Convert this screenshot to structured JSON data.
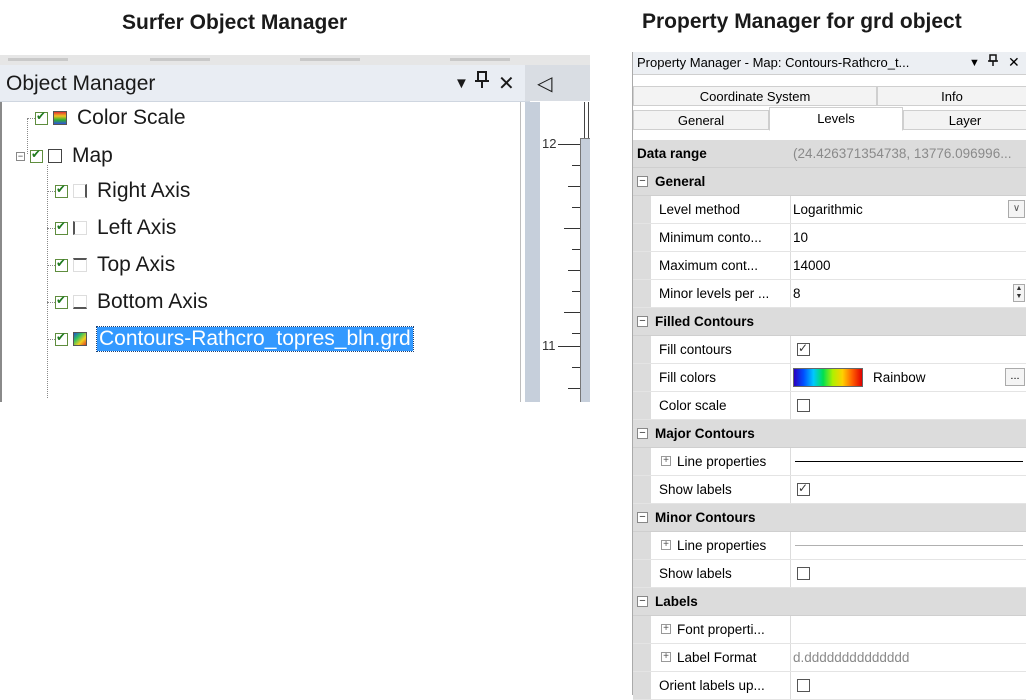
{
  "headings": {
    "left": "Surfer Object Manager",
    "right": "Property Manager for grd object"
  },
  "object_manager": {
    "title": "Object Manager",
    "title_icons": [
      "dropdown-arrow-icon",
      "pin-icon",
      "close-icon"
    ],
    "items": [
      {
        "label": "Color Scale",
        "checked": true,
        "icon": "color-scale-icon"
      },
      {
        "label": "Map",
        "checked": true,
        "icon": "map-icon",
        "expanded": true
      },
      {
        "label": "Right Axis",
        "checked": true,
        "icon": "right-axis-icon"
      },
      {
        "label": "Left Axis",
        "checked": true,
        "icon": "left-axis-icon"
      },
      {
        "label": "Top Axis",
        "checked": true,
        "icon": "top-axis-icon"
      },
      {
        "label": "Bottom Axis",
        "checked": true,
        "icon": "bottom-axis-icon"
      },
      {
        "label": "Contours-Rathcro_topres_bln.grd",
        "checked": true,
        "icon": "contour-layer-icon",
        "selected": true
      }
    ]
  },
  "plot_document": {
    "tab_arrow": "◁",
    "ruler_labels": [
      "12",
      "11"
    ]
  },
  "property_manager": {
    "title": "Property Manager - Map: Contours-Rathcro_t...",
    "title_icons": [
      "dropdown-arrow-icon",
      "pin-icon",
      "close-icon"
    ],
    "tabs_row1": [
      "Coordinate System",
      "Info"
    ],
    "tabs_row2": [
      "General",
      "Levels",
      "Layer"
    ],
    "active_tab": "Levels",
    "data_range": {
      "label": "Data range",
      "value": "(24.426371354738, 13776.096996..."
    },
    "sections": {
      "general": {
        "title": "General",
        "level_method": {
          "label": "Level method",
          "value": "Logarithmic"
        },
        "min_contour": {
          "label": "Minimum conto...",
          "value": "10"
        },
        "max_contour": {
          "label": "Maximum cont...",
          "value": "14000"
        },
        "minor_levels": {
          "label": "Minor levels per ...",
          "value": "8"
        }
      },
      "filled_contours": {
        "title": "Filled Contours",
        "fill_contours": {
          "label": "Fill contours",
          "checked": true
        },
        "fill_colors": {
          "label": "Fill colors",
          "value": "Rainbow",
          "ellipsis": "..."
        },
        "color_scale": {
          "label": "Color scale",
          "checked": false
        }
      },
      "major_contours": {
        "title": "Major Contours",
        "line_properties": {
          "label": "Line properties"
        },
        "show_labels": {
          "label": "Show labels",
          "checked": true
        }
      },
      "minor_contours": {
        "title": "Minor Contours",
        "line_properties": {
          "label": "Line properties"
        },
        "show_labels": {
          "label": "Show labels",
          "checked": false
        }
      },
      "labels": {
        "title": "Labels",
        "font_properties": {
          "label": "Font properti..."
        },
        "label_format": {
          "label": "Label Format",
          "value": "d.dddddddddddddd"
        },
        "orient_labels": {
          "label": "Orient labels up...",
          "checked": false
        }
      }
    }
  }
}
